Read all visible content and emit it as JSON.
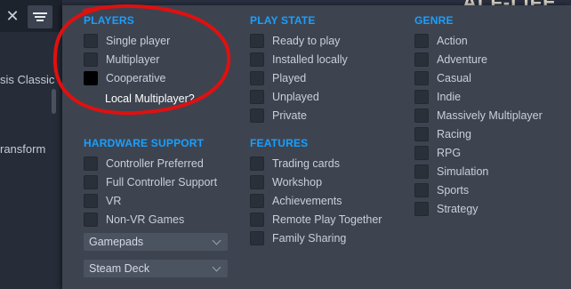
{
  "app": {
    "close_glyph": "✕",
    "background_items": [
      "sis Classic",
      "ransform"
    ],
    "hero_fragment": "ALF-LIFE"
  },
  "colors": {
    "panel_bg": "#3d4450",
    "section_title": "#1a9fff",
    "annotation_red": "#e01010"
  },
  "players": {
    "title": "PLAYERS",
    "options": [
      {
        "label": "Single player",
        "checked": false
      },
      {
        "label": "Multiplayer",
        "checked": false
      },
      {
        "label": "Cooperative",
        "checked": true
      }
    ],
    "annotation": "Local Multiplayer?"
  },
  "play_state": {
    "title": "PLAY STATE",
    "options": [
      {
        "label": "Ready to play",
        "checked": false
      },
      {
        "label": "Installed locally",
        "checked": false
      },
      {
        "label": "Played",
        "checked": false
      },
      {
        "label": "Unplayed",
        "checked": false
      },
      {
        "label": "Private",
        "checked": false
      }
    ]
  },
  "genre": {
    "title": "GENRE",
    "options": [
      {
        "label": "Action",
        "checked": false
      },
      {
        "label": "Adventure",
        "checked": false
      },
      {
        "label": "Casual",
        "checked": false
      },
      {
        "label": "Indie",
        "checked": false
      },
      {
        "label": "Massively Multiplayer",
        "checked": false
      },
      {
        "label": "Racing",
        "checked": false
      },
      {
        "label": "RPG",
        "checked": false
      },
      {
        "label": "Simulation",
        "checked": false
      },
      {
        "label": "Sports",
        "checked": false
      },
      {
        "label": "Strategy",
        "checked": false
      }
    ]
  },
  "hardware_support": {
    "title": "HARDWARE SUPPORT",
    "options": [
      {
        "label": "Controller Preferred",
        "checked": false
      },
      {
        "label": "Full Controller Support",
        "checked": false
      },
      {
        "label": "VR",
        "checked": false
      },
      {
        "label": "Non-VR Games",
        "checked": false
      }
    ],
    "dropdowns": [
      {
        "value": "Gamepads"
      },
      {
        "value": "Steam Deck"
      }
    ]
  },
  "features": {
    "title": "FEATURES",
    "options": [
      {
        "label": "Trading cards",
        "checked": false
      },
      {
        "label": "Workshop",
        "checked": false
      },
      {
        "label": "Achievements",
        "checked": false
      },
      {
        "label": "Remote Play Together",
        "checked": false
      },
      {
        "label": "Family Sharing",
        "checked": false
      }
    ]
  }
}
